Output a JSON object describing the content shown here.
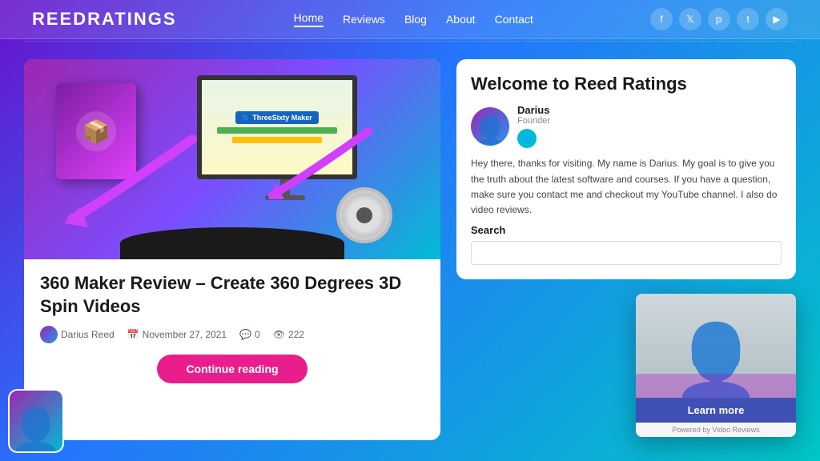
{
  "header": {
    "logo": "ReedRatings",
    "nav": [
      {
        "label": "Home",
        "active": true
      },
      {
        "label": "Reviews",
        "active": false
      },
      {
        "label": "Blog",
        "active": false
      },
      {
        "label": "About",
        "active": false
      },
      {
        "label": "Contact",
        "active": false
      }
    ],
    "social": [
      "f",
      "t",
      "p",
      "t2",
      "yt"
    ]
  },
  "article": {
    "title": "360 Maker Review – Create 360 Degrees 3D Spin Videos",
    "author": "Darius Reed",
    "date": "November 27, 2021",
    "comments": "0",
    "views": "222",
    "continue_reading": "Continue reading"
  },
  "sidebar": {
    "welcome_title": "Welcome to Reed Ratings",
    "author_name": "Darius",
    "author_role": "Founder",
    "welcome_text": "Hey there, thanks for visiting. My name is Darius. My goal is to give you the truth about the latest software and courses. If you have a question, make sure you contact me and checkout my YouTube channel. I also do video reviews.",
    "search_label": "Search",
    "search_placeholder": ""
  },
  "video_popup": {
    "learn_more": "Learn more",
    "footer": "Powered by Video Reviews"
  }
}
